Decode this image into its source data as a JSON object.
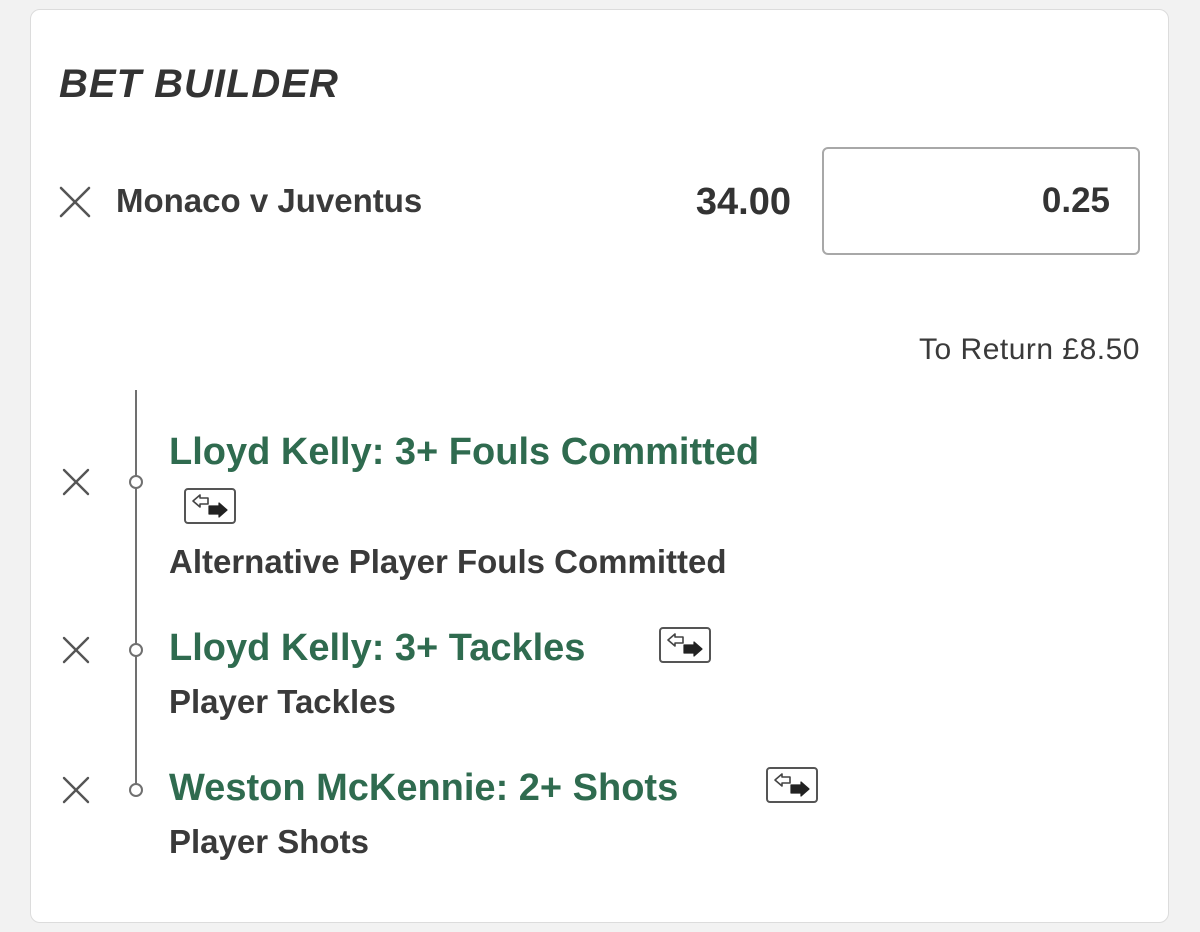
{
  "title": "BET BUILDER",
  "match": {
    "name": "Monaco v Juventus",
    "odds": "34.00",
    "stake": "0.25"
  },
  "to_return": "To Return £8.50",
  "selections": [
    {
      "title": "Lloyd Kelly: 3+ Fouls Committed",
      "market": "Alternative Player Fouls Committed"
    },
    {
      "title": "Lloyd Kelly: 3+ Tackles",
      "market": "Player Tackles"
    },
    {
      "title": "Weston McKennie: 2+ Shots",
      "market": "Player Shots"
    }
  ],
  "icons": {
    "remove": "close-icon",
    "swap": "swap-arrows-icon"
  },
  "colors": {
    "selection_green": "#2f6b4f",
    "text_dark": "#333333"
  }
}
